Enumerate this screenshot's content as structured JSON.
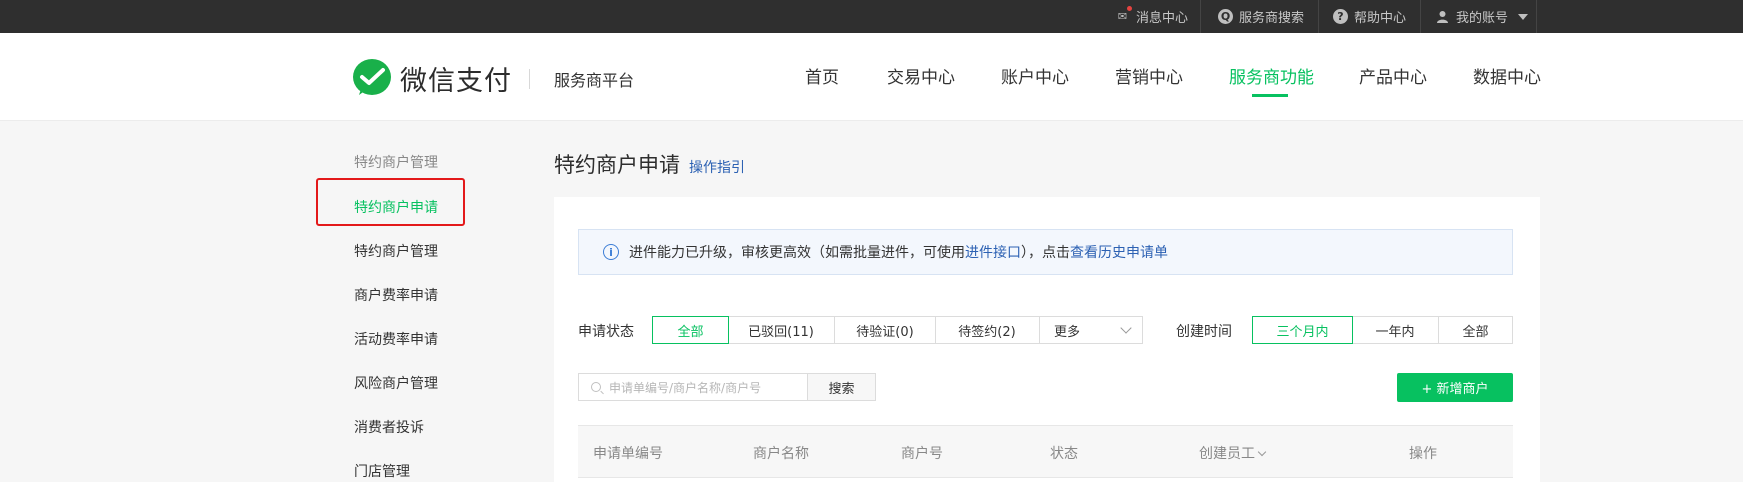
{
  "topbar": {
    "messages": "消息中心",
    "search": "服务商搜索",
    "help": "帮助中心",
    "account": "我的账号"
  },
  "header": {
    "logo_text": "微信支付",
    "platform": "服务商平台",
    "nav": [
      "首页",
      "交易中心",
      "账户中心",
      "营销中心",
      "服务商功能",
      "产品中心",
      "数据中心"
    ],
    "active_nav": "服务商功能"
  },
  "sidebar": {
    "group_title": "特约商户管理",
    "items": [
      "特约商户申请",
      "特约商户管理",
      "商户费率申请",
      "活动费率申请",
      "风险商户管理",
      "消费者投诉",
      "门店管理"
    ],
    "active_item": "特约商户申请"
  },
  "main": {
    "title": "特约商户申请",
    "guide_link": "操作指引",
    "notice": {
      "text_before": "进件能力已升级，审核更高效（如需批量进件，可使用 ",
      "link1": "进件接口",
      "text_middle": "），点击 ",
      "link2": "查看历史申请单"
    },
    "status_filter": {
      "label": "申请状态",
      "options": [
        "全部",
        "已驳回(11)",
        "待验证(0)",
        "待签约(2)"
      ],
      "selected": "全部",
      "more": "更多"
    },
    "time_filter": {
      "label": "创建时间",
      "options": [
        "三个月内",
        "一年内",
        "全部"
      ],
      "selected": "三个月内"
    },
    "search": {
      "placeholder": "申请单编号/商户名称/商户号",
      "button": "搜索"
    },
    "add_button": "+ 新增商户",
    "table_headers": [
      "申请单编号",
      "商户名称",
      "商户号",
      "状态",
      "创建员工",
      "操作"
    ]
  },
  "colors": {
    "brand_green": "#07c160",
    "link_blue": "#2c61b3",
    "highlight_red": "#e3191a",
    "topbar_bg": "#2f2f2f"
  }
}
